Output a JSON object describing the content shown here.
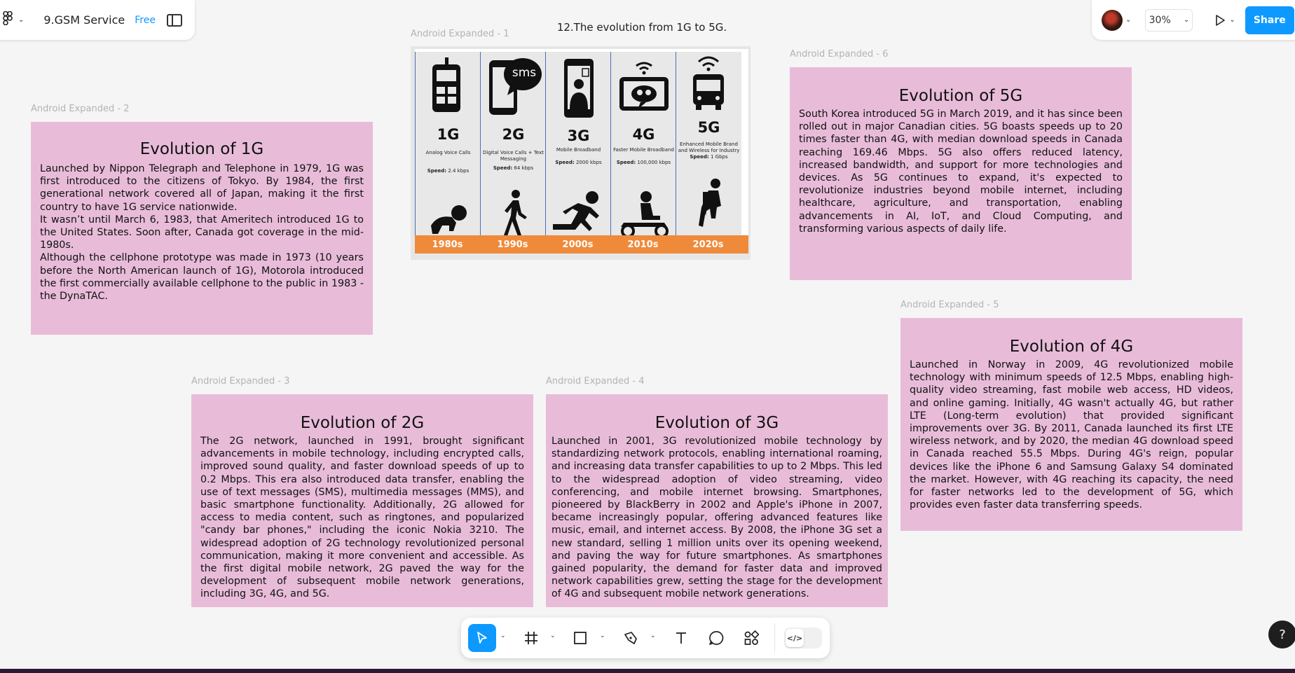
{
  "app": {
    "file_name": "9.GSM Service",
    "plan_badge": "Free",
    "page_title": "12.The evolution from 1G to 5G.",
    "zoom": "30%",
    "share_label": "Share",
    "help_label": "?"
  },
  "frames": {
    "f1": {
      "label": "Android Expanded - 1"
    },
    "f2": {
      "label": "Android Expanded - 2",
      "title": "Evolution of 1G",
      "paragraphs": [
        "Launched by Nippon Telegraph and Telephone in 1979, 1G was first introduced to the citizens of Tokyo. By 1984, the first generational network covered all of Japan, making it the first country to have 1G service nationwide.",
        "It wasn’t until March 6, 1983, that Ameritech introduced 1G to the United States. Soon after, Canada got coverage in the mid-1980s.",
        "Although the cellphone prototype was made in 1973 (10 years before the North American launch of 1G), Motorola introduced the first commercially available cellphone to the public in 1983 - the DynaTAC."
      ]
    },
    "f3": {
      "label": "Android Expanded - 3",
      "title": "Evolution of 2G",
      "paragraphs": [
        "The 2G network, launched in 1991, brought significant advancements in mobile technology, including encrypted calls, improved sound quality, and faster download speeds of up to 0.2 Mbps. This era also introduced data transfer, enabling the use of text messages (SMS), multimedia messages (MMS), and basic smartphone functionality. Additionally, 2G allowed for access to media content, such as ringtones, and popularized \"candy bar phones,\" including the iconic Nokia 3210. The widespread adoption of 2G technology revolutionized personal communication, making it more convenient and accessible. As the first digital mobile network, 2G paved the way for the development of subsequent mobile network generations, including 3G, 4G, and 5G."
      ]
    },
    "f4": {
      "label": "Android Expanded - 4",
      "title": "Evolution of 3G",
      "paragraphs": [
        "Launched in 2001, 3G revolutionized mobile technology by standardizing network protocols, enabling international roaming, and increasing data transfer capabilities to up to 2 Mbps. This led to the widespread adoption of video streaming, video conferencing, and mobile internet browsing. Smartphones, pioneered by BlackBerry in 2002 and Apple's iPhone in 2007, became increasingly popular, offering advanced features like music, email, and internet access. By 2008, the iPhone 3G set a new standard, selling 1 million units over its opening weekend, and paving the way for future smartphones. As smartphones gained popularity, the demand for faster data and improved network capabilities grew, setting the stage for the development of 4G and subsequent mobile network generations."
      ]
    },
    "f5": {
      "label": "Android Expanded - 5",
      "title": "Evolution of 4G",
      "paragraphs": [
        "Launched in Norway in 2009, 4G revolutionized mobile technology with minimum speeds of 12.5 Mbps, enabling high-quality video streaming, fast mobile web access, HD videos, and online gaming. Initially, 4G wasn't actually 4G, but rather LTE (Long-term evolution) that provided significant improvements over 3G. By 2011, Canada launched its first LTE wireless network, and by 2020, the median 4G download speed in Canada reached 55.5 Mbps. During 4G's reign, popular devices like the iPhone 6 and Samsung Galaxy S4 dominated the market. However, with 4G reaching its capacity, the need for faster networks led to the development of 5G, which provides even faster data transferring speeds."
      ]
    },
    "f6": {
      "label": "Android Expanded - 6",
      "title": "Evolution of 5G",
      "paragraphs": [
        "South Korea introduced 5G in March 2019, and it has since been rolled out in major Canadian cities. 5G boasts speeds up to 20 times faster than 4G, with median download speeds in Canada reaching 169.46 Mbps. 5G also offers reduced latency, increased bandwidth, and support for more technologies and devices. As 5G continues to expand, it's expected to revolutionize industries beyond mobile internet, including healthcare, agriculture, and transportation, enabling advancements in AI, IoT, and Cloud Computing, and transforming various aspects of daily life."
      ]
    }
  },
  "infographic": {
    "sms_text": "sms",
    "generations": [
      {
        "name": "1G",
        "desc": "Analog Voice Calls",
        "speed_label": "Speed:",
        "speed": "2.4 kbps",
        "decade": "1980s"
      },
      {
        "name": "2G",
        "desc": "Digital Voice Calls + Text Messaging",
        "speed_label": "Speed:",
        "speed": "64 kbps",
        "decade": "1990s"
      },
      {
        "name": "3G",
        "desc": "Mobile Broadband",
        "speed_label": "Speed:",
        "speed": "2000 kbps",
        "decade": "2000s"
      },
      {
        "name": "4G",
        "desc": "Faster Mobile Broadband",
        "speed_label": "Speed:",
        "speed": "100,000 kbps",
        "decade": "2010s"
      },
      {
        "name": "5G",
        "desc": "Enhanced Mobile Brand and Wireless for Industry",
        "speed_label": "Speed:",
        "speed": "1 Gbps",
        "decade": "2020s"
      }
    ]
  },
  "toolbar": {
    "tools": [
      "move-tool",
      "frame-tool",
      "shape-tool",
      "pen-tool",
      "text-tool",
      "comment-tool",
      "actions-tool"
    ],
    "code_toggle": "</>"
  },
  "colors": {
    "frame_fill": "#e8bcd9",
    "accent": "#0d99ff",
    "decade_bar": "#ef8a3a",
    "column_border": "#4c6fb4"
  }
}
